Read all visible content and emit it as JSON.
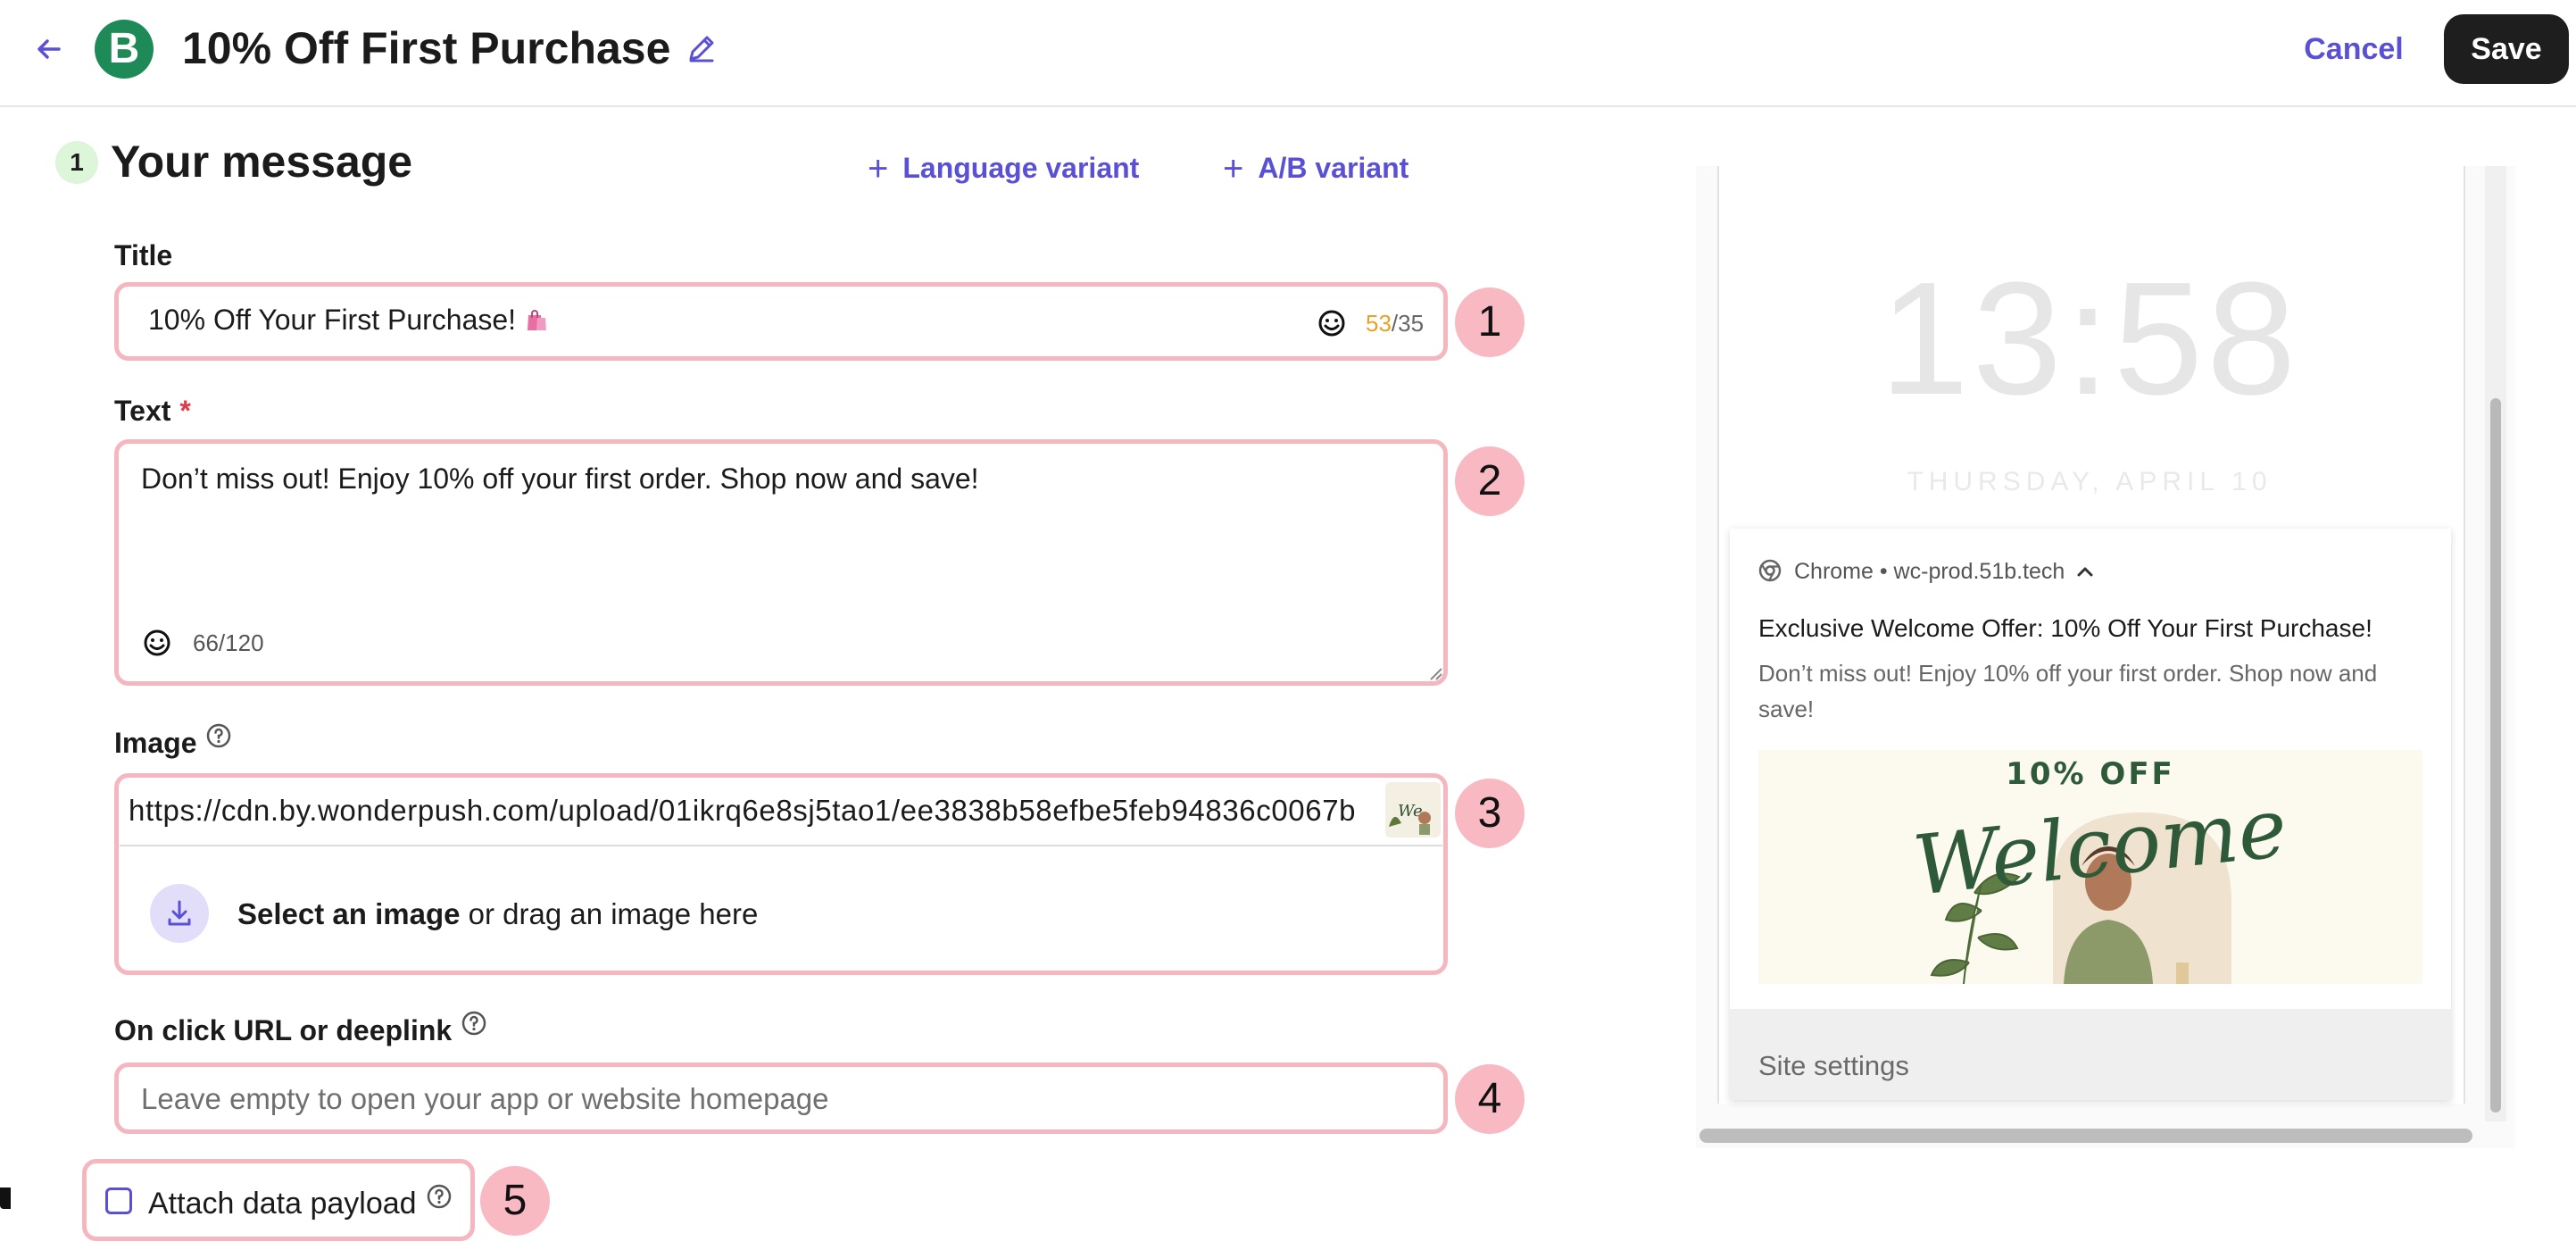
{
  "header": {
    "title": "10% Off First Purchase",
    "brand_letter": "B",
    "cancel_label": "Cancel",
    "save_label": "Save"
  },
  "section": {
    "step": "1",
    "title": "Your message",
    "language_variant": "Language variant",
    "ab_variant": "A/B variant"
  },
  "form": {
    "title_label": "Title",
    "title_value": "10% Off Your First Purchase!",
    "title_count_used": "53",
    "title_count_max": "/35",
    "text_label": "Text",
    "text_required": "*",
    "text_value": "Don’t miss out! Enjoy 10% off your first order. Shop now and save!",
    "text_count": "66/120",
    "image_label": "Image",
    "image_url": "https://cdn.by.wonderpush.com/upload/01ikrq6e8sj5tao1/ee3838b58efbe5feb94836c0067b",
    "upload_strong": "Select an image",
    "upload_rest": " or drag an image here",
    "deeplink_label": "On click URL or deeplink",
    "deeplink_placeholder": "Leave empty to open your app or website homepage",
    "payload_label": "Attach data payload"
  },
  "annotations": [
    "1",
    "2",
    "3",
    "4",
    "5"
  ],
  "preview": {
    "time": "13:58",
    "date": "THURSDAY, APRIL 10",
    "source": "Chrome • wc-prod.51b.tech",
    "title": "Exclusive Welcome Offer: 10% Off Your First Purchase!",
    "body": "Don’t miss out! Enjoy 10% off your first order. Shop now and save!",
    "image_heading": "10% OFF",
    "image_script": "Welcome",
    "settings": "Site settings"
  },
  "colors": {
    "accent": "#5a50d6",
    "brand": "#1e8a58",
    "annotation": "#f8b9c3",
    "counter_over": "#e8a225",
    "required": "#e03a4a"
  }
}
